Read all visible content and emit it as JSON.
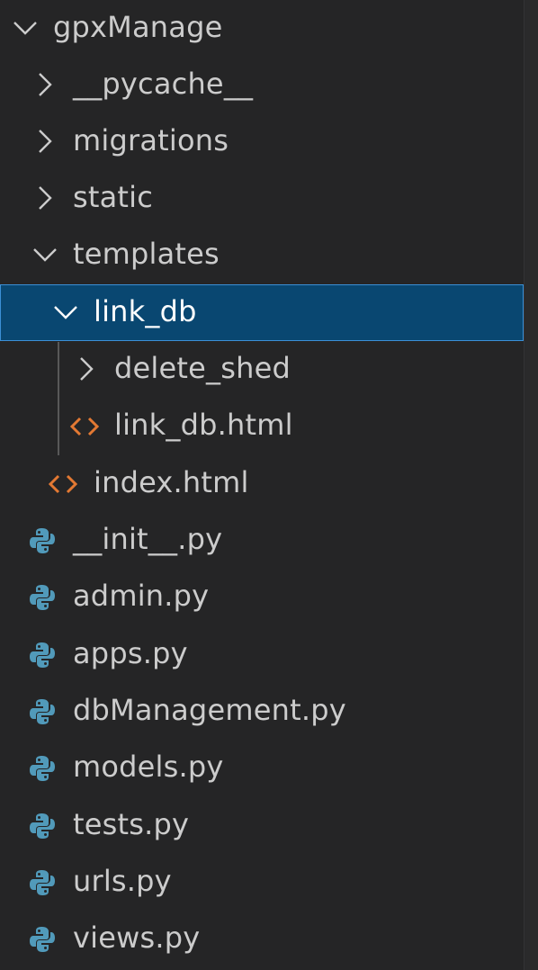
{
  "explorer": {
    "items": [
      {
        "label": "gpxManage",
        "icon": "chevron-down-icon"
      },
      {
        "label": "__pycache__",
        "icon": "chevron-right-icon"
      },
      {
        "label": "migrations",
        "icon": "chevron-right-icon"
      },
      {
        "label": "static",
        "icon": "chevron-right-icon"
      },
      {
        "label": "templates",
        "icon": "chevron-down-icon"
      },
      {
        "label": "link_db",
        "icon": "chevron-down-icon",
        "selected": true
      },
      {
        "label": "delete_shed",
        "icon": "chevron-right-icon"
      },
      {
        "label": "link_db.html",
        "icon": "html-file-icon"
      },
      {
        "label": "index.html",
        "icon": "html-file-icon"
      },
      {
        "label": "__init__.py",
        "icon": "python-file-icon"
      },
      {
        "label": "admin.py",
        "icon": "python-file-icon"
      },
      {
        "label": "apps.py",
        "icon": "python-file-icon"
      },
      {
        "label": "dbManagement.py",
        "icon": "python-file-icon"
      },
      {
        "label": "models.py",
        "icon": "python-file-icon"
      },
      {
        "label": "tests.py",
        "icon": "python-file-icon"
      },
      {
        "label": "urls.py",
        "icon": "python-file-icon"
      },
      {
        "label": "views.py",
        "icon": "python-file-icon"
      }
    ]
  },
  "colors": {
    "background": "#252526",
    "selection": "#094771",
    "selection_border": "#3b8fd6",
    "text": "#cccccc",
    "html_icon": "#e37933",
    "python_icon": "#519aba"
  }
}
